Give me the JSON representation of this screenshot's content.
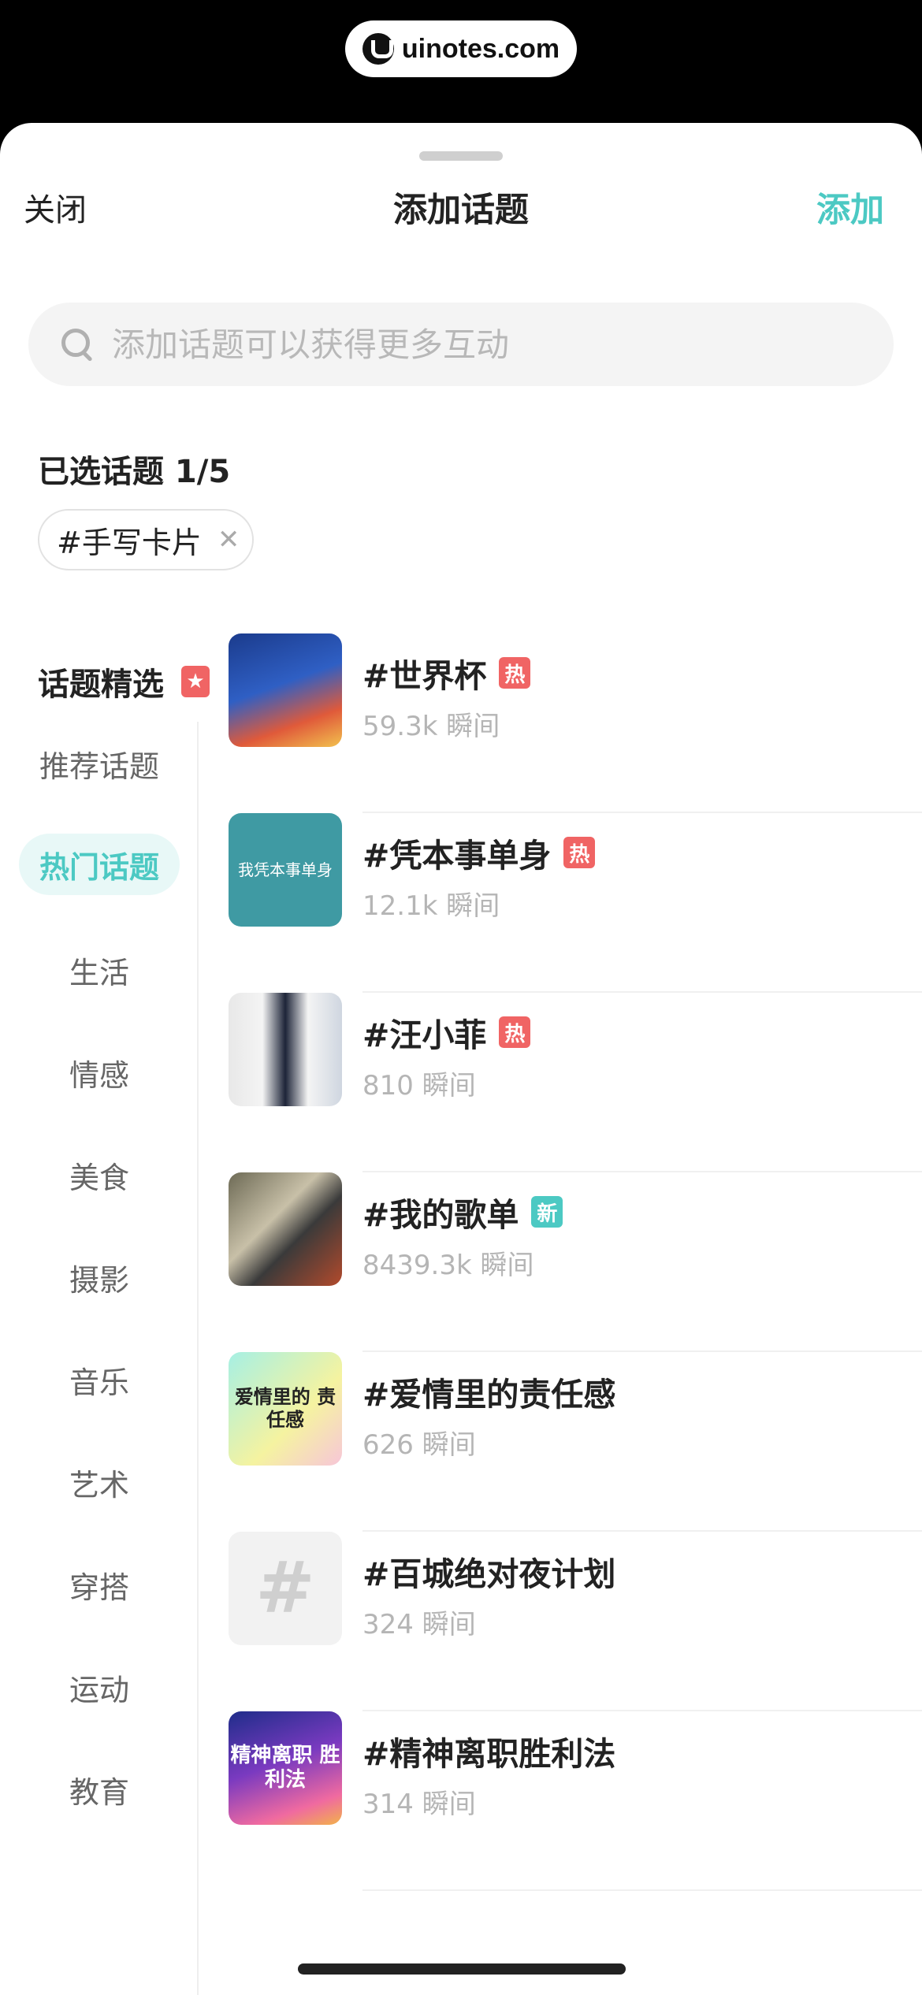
{
  "watermark": {
    "text": "uinotes.com"
  },
  "header": {
    "close_label": "关闭",
    "title": "添加话题",
    "add_label": "添加"
  },
  "search": {
    "placeholder": "添加话题可以获得更多互动"
  },
  "selected": {
    "heading": "已选话题 1/5",
    "chips": [
      {
        "label": "#手写卡片"
      }
    ]
  },
  "featured": {
    "heading": "话题精选",
    "badge_icon": "star-badge-icon"
  },
  "nav": {
    "active_index": 1,
    "items": [
      {
        "label": "推荐话题"
      },
      {
        "label": "热门话题"
      },
      {
        "label": "生活"
      },
      {
        "label": "情感"
      },
      {
        "label": "美食"
      },
      {
        "label": "摄影"
      },
      {
        "label": "音乐"
      },
      {
        "label": "艺术"
      },
      {
        "label": "穿搭"
      },
      {
        "label": "运动"
      },
      {
        "label": "教育"
      }
    ]
  },
  "topics": [
    {
      "name": "#世界杯",
      "tag": "热",
      "tag_type": "hot",
      "count": "59.3k 瞬间",
      "thumb": "football-fans-image"
    },
    {
      "name": "#凭本事单身",
      "tag": "热",
      "tag_type": "hot",
      "count": "12.1k 瞬间",
      "thumb": "text-cover-image",
      "thumb_text": "我凭本事单身"
    },
    {
      "name": "#汪小菲",
      "tag": "热",
      "tag_type": "hot",
      "count": "810 瞬间",
      "thumb": "portrait-image"
    },
    {
      "name": "#我的歌单",
      "tag": "新",
      "tag_type": "new",
      "count": "8439.3k 瞬间",
      "thumb": "cassette-image"
    },
    {
      "name": "#爱情里的责任感",
      "tag": "",
      "tag_type": "",
      "count": "626 瞬间",
      "thumb": "love-cover-image",
      "thumb_text": "爱情里的 责任感"
    },
    {
      "name": "#百城绝对夜计划",
      "tag": "",
      "tag_type": "",
      "count": "324 瞬间",
      "thumb": "hash-placeholder-icon",
      "thumb_text": "#"
    },
    {
      "name": "#精神离职胜利法",
      "tag": "",
      "tag_type": "",
      "count": "314 瞬间",
      "thumb": "neon-cover-image",
      "thumb_text": "精神离职 胜利法"
    }
  ],
  "colors": {
    "accent": "#4cc9c3",
    "hot": "#f06464",
    "muted": "#b5b5b5"
  }
}
